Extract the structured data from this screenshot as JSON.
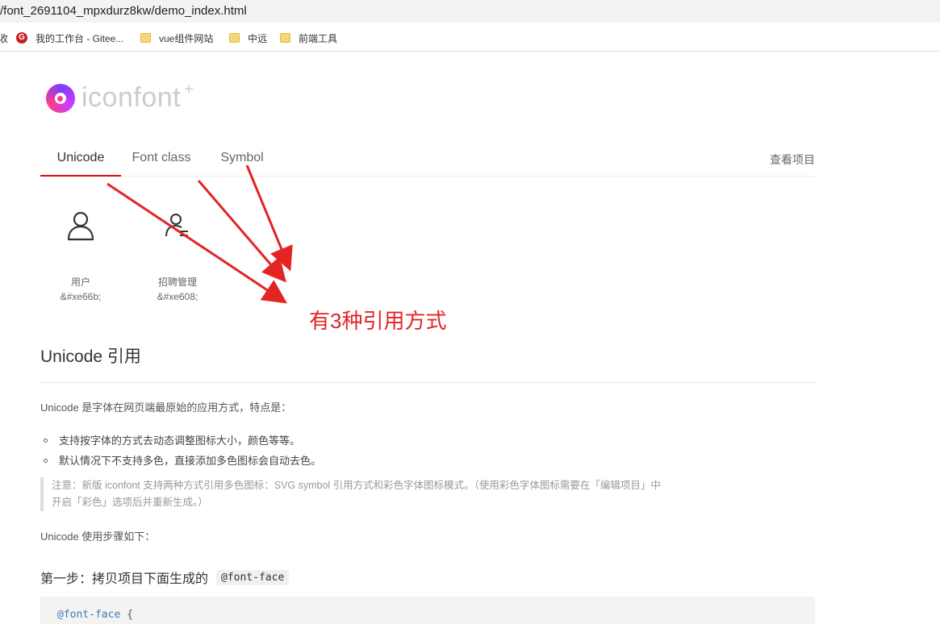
{
  "browser": {
    "url": "/font_2691104_mpxdurz8kw/demo_index.html",
    "bookmarks": [
      {
        "label": "我的工作台 - Gitee...",
        "icon": "gitee-icon"
      },
      {
        "label": "vue组件网站",
        "icon": "folder-icon"
      },
      {
        "label": "中远",
        "icon": "folder-icon"
      },
      {
        "label": "前端工具",
        "icon": "folder-icon"
      }
    ],
    "bookmark_edge_text": "收"
  },
  "logo": {
    "text": "iconfont",
    "plus": "+"
  },
  "tabs": {
    "items": [
      {
        "label": "Unicode",
        "active": true
      },
      {
        "label": "Font class",
        "active": false
      },
      {
        "label": "Symbol",
        "active": false
      }
    ],
    "view_project": "查看项目"
  },
  "icons": [
    {
      "name": "用户",
      "code": "&#xe66b;",
      "icon": "user-icon"
    },
    {
      "name": "招聘管理",
      "code": "&#xe608;",
      "icon": "recruit-icon"
    }
  ],
  "annotation": {
    "text": "有3种引用方式",
    "color": "#e32424"
  },
  "content": {
    "heading": "Unicode 引用",
    "intro": "Unicode 是字体在网页端最原始的应用方式，特点是：",
    "bullets": [
      "支持按字体的方式去动态调整图标大小，颜色等等。",
      "默认情况下不支持多色，直接添加多色图标会自动去色。"
    ],
    "note_line1": "注意：新版 iconfont 支持两种方式引用多色图标：SVG symbol 引用方式和彩色字体图标模式。（使用彩色字体图标需要在「编辑项目」中",
    "note_line2": "开启「彩色」选项后并重新生成。）",
    "steps_intro": "Unicode 使用步骤如下：",
    "step1_label": "第一步：拷贝项目下面生成的",
    "step1_code": "@font-face",
    "code_keyword": "@font-face",
    "code_brace": "{"
  },
  "colors": {
    "accent_red": "#e50000",
    "annotation_red": "#e32424"
  }
}
